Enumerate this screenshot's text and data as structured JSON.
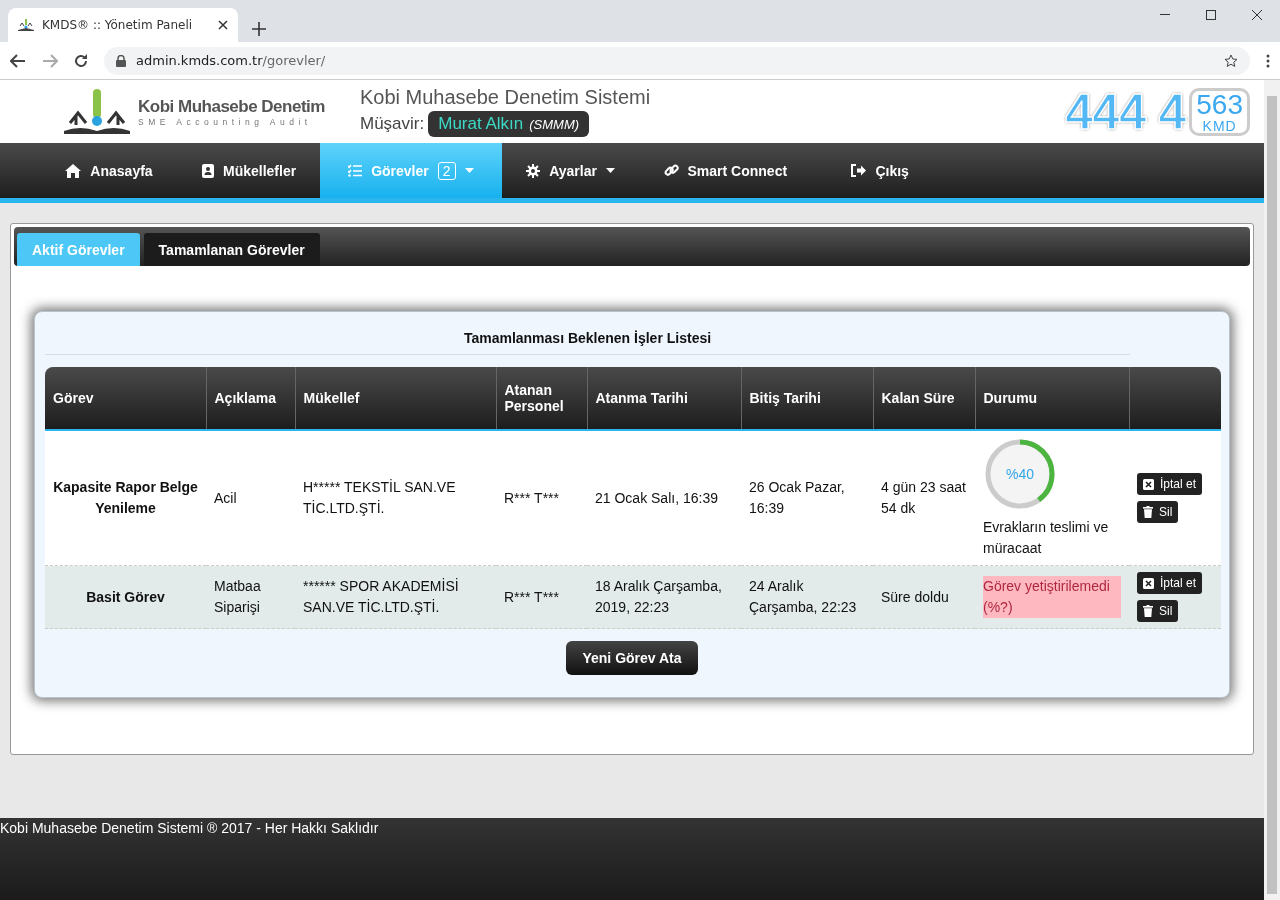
{
  "browser": {
    "tab_title": "KMDS® :: Yönetim Paneli",
    "url_host": "admin.kmds.com.tr",
    "url_path": "/gorevler/"
  },
  "header": {
    "logo_name": "Kobi Muhasebe Denetim",
    "logo_tagline": "SME Accounting Audit",
    "site_title": "Kobi Muhasebe Denetim Sistemi",
    "advisor_label": "Müşavir:",
    "advisor_name": "Murat Alkın",
    "advisor_title": "(SMMM)",
    "phone_main": "444 4",
    "phone_end": "563",
    "phone_brand": "KMD"
  },
  "nav": [
    {
      "label": "Anasayfa",
      "kind": "home",
      "selected": false,
      "dropdown": false
    },
    {
      "label": "Mükellefler",
      "kind": "contacts",
      "selected": false,
      "dropdown": false
    },
    {
      "label": "Görevler",
      "kind": "tasks",
      "selected": true,
      "dropdown": true,
      "badge": "2"
    },
    {
      "label": "Ayarlar",
      "kind": "gear",
      "selected": false,
      "dropdown": true
    },
    {
      "label": "Smart Connect",
      "kind": "link",
      "selected": false,
      "dropdown": false
    },
    {
      "label": "Çıkış",
      "kind": "exit",
      "selected": false,
      "dropdown": false
    }
  ],
  "subtabs": [
    {
      "label": "Aktif Görevler",
      "selected": true
    },
    {
      "label": "Tamamlanan Görevler",
      "selected": false
    }
  ],
  "table": {
    "title": "Tamamlanması Beklenen İşler Listesi",
    "columns": [
      "Görev",
      "Açıklama",
      "Mükellef",
      "Atanan Personel",
      "Atanma Tarihi",
      "Bitiş Tarihi",
      "Kalan Süre",
      "Durumu"
    ],
    "rows": [
      {
        "task": "Kapasite Rapor Belge Yenileme",
        "description": "Acil",
        "taxpayer": "H***** TEKSTİL SAN.VE TİC.LTD.ŞTİ.",
        "staff": "R*** T***",
        "assigned": "21 Ocak Salı, 16:39",
        "due": "26 Ocak Pazar, 16:39",
        "remaining": "4 gün 23 saat 54 dk",
        "status": {
          "kind": "progress",
          "level": 0.4,
          "percent": "%40",
          "caption": "Evrakların teslimi ve müracaat"
        },
        "actions": [
          {
            "kind": "cancel",
            "label": "İptal et"
          },
          {
            "kind": "delete",
            "label": "Sil"
          }
        ]
      },
      {
        "task": "Basit Görev",
        "description": "Matbaa Siparişi",
        "taxpayer": "****** SPOR AKADEMİSİ SAN.VE TİC.LTD.ŞTİ.",
        "staff": "R*** T***",
        "assigned": "18 Aralık Çarşamba, 2019, 22:23",
        "due": "24 Aralık Çarşamba, 22:23",
        "remaining": "Süre doldu",
        "status": {
          "kind": "overdue",
          "text": "Görev yetiştirilemedi (%?)"
        },
        "actions": [
          {
            "kind": "cancel",
            "label": "İptal et"
          },
          {
            "kind": "delete",
            "label": "Sil"
          }
        ]
      }
    ]
  },
  "add_button": "Yeni Görev Ata",
  "footer": "Kobi Muhasebe Denetim Sistemi ® 2017 - Her Hakkı Saklıdır"
}
